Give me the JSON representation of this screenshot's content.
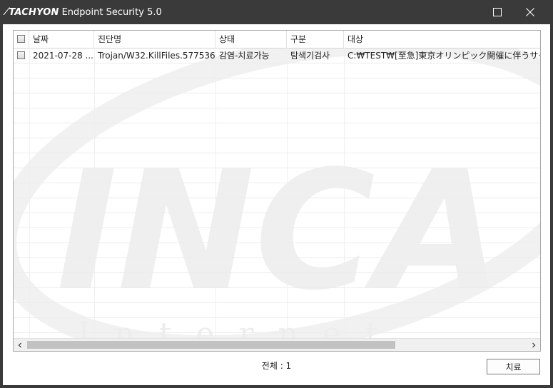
{
  "window": {
    "brand": "TACHYON",
    "title": "Endpoint Security 5.0",
    "maximize_icon": "maximize-icon",
    "close_icon": "close-icon"
  },
  "table": {
    "columns": [
      "날짜",
      "진단명",
      "상태",
      "구분",
      "대상"
    ],
    "rows": [
      {
        "checked": false,
        "date": "2021-07-28 ...",
        "name": "Trojan/W32.KillFiles.577536",
        "status": "감염-치료가능",
        "type": "탐색기검사",
        "target": "C:₩TEST₩[至急]東京オリンピック開催に伴うサイ"
      }
    ],
    "scroll_left_icon": "chevron-left-icon",
    "scroll_right_icon": "chevron-right-icon"
  },
  "footer": {
    "total_label": "전체 : 1",
    "cure_button": "치료"
  },
  "colors": {
    "titlebar": "#3a3a3a",
    "watermark": "#ececec"
  }
}
